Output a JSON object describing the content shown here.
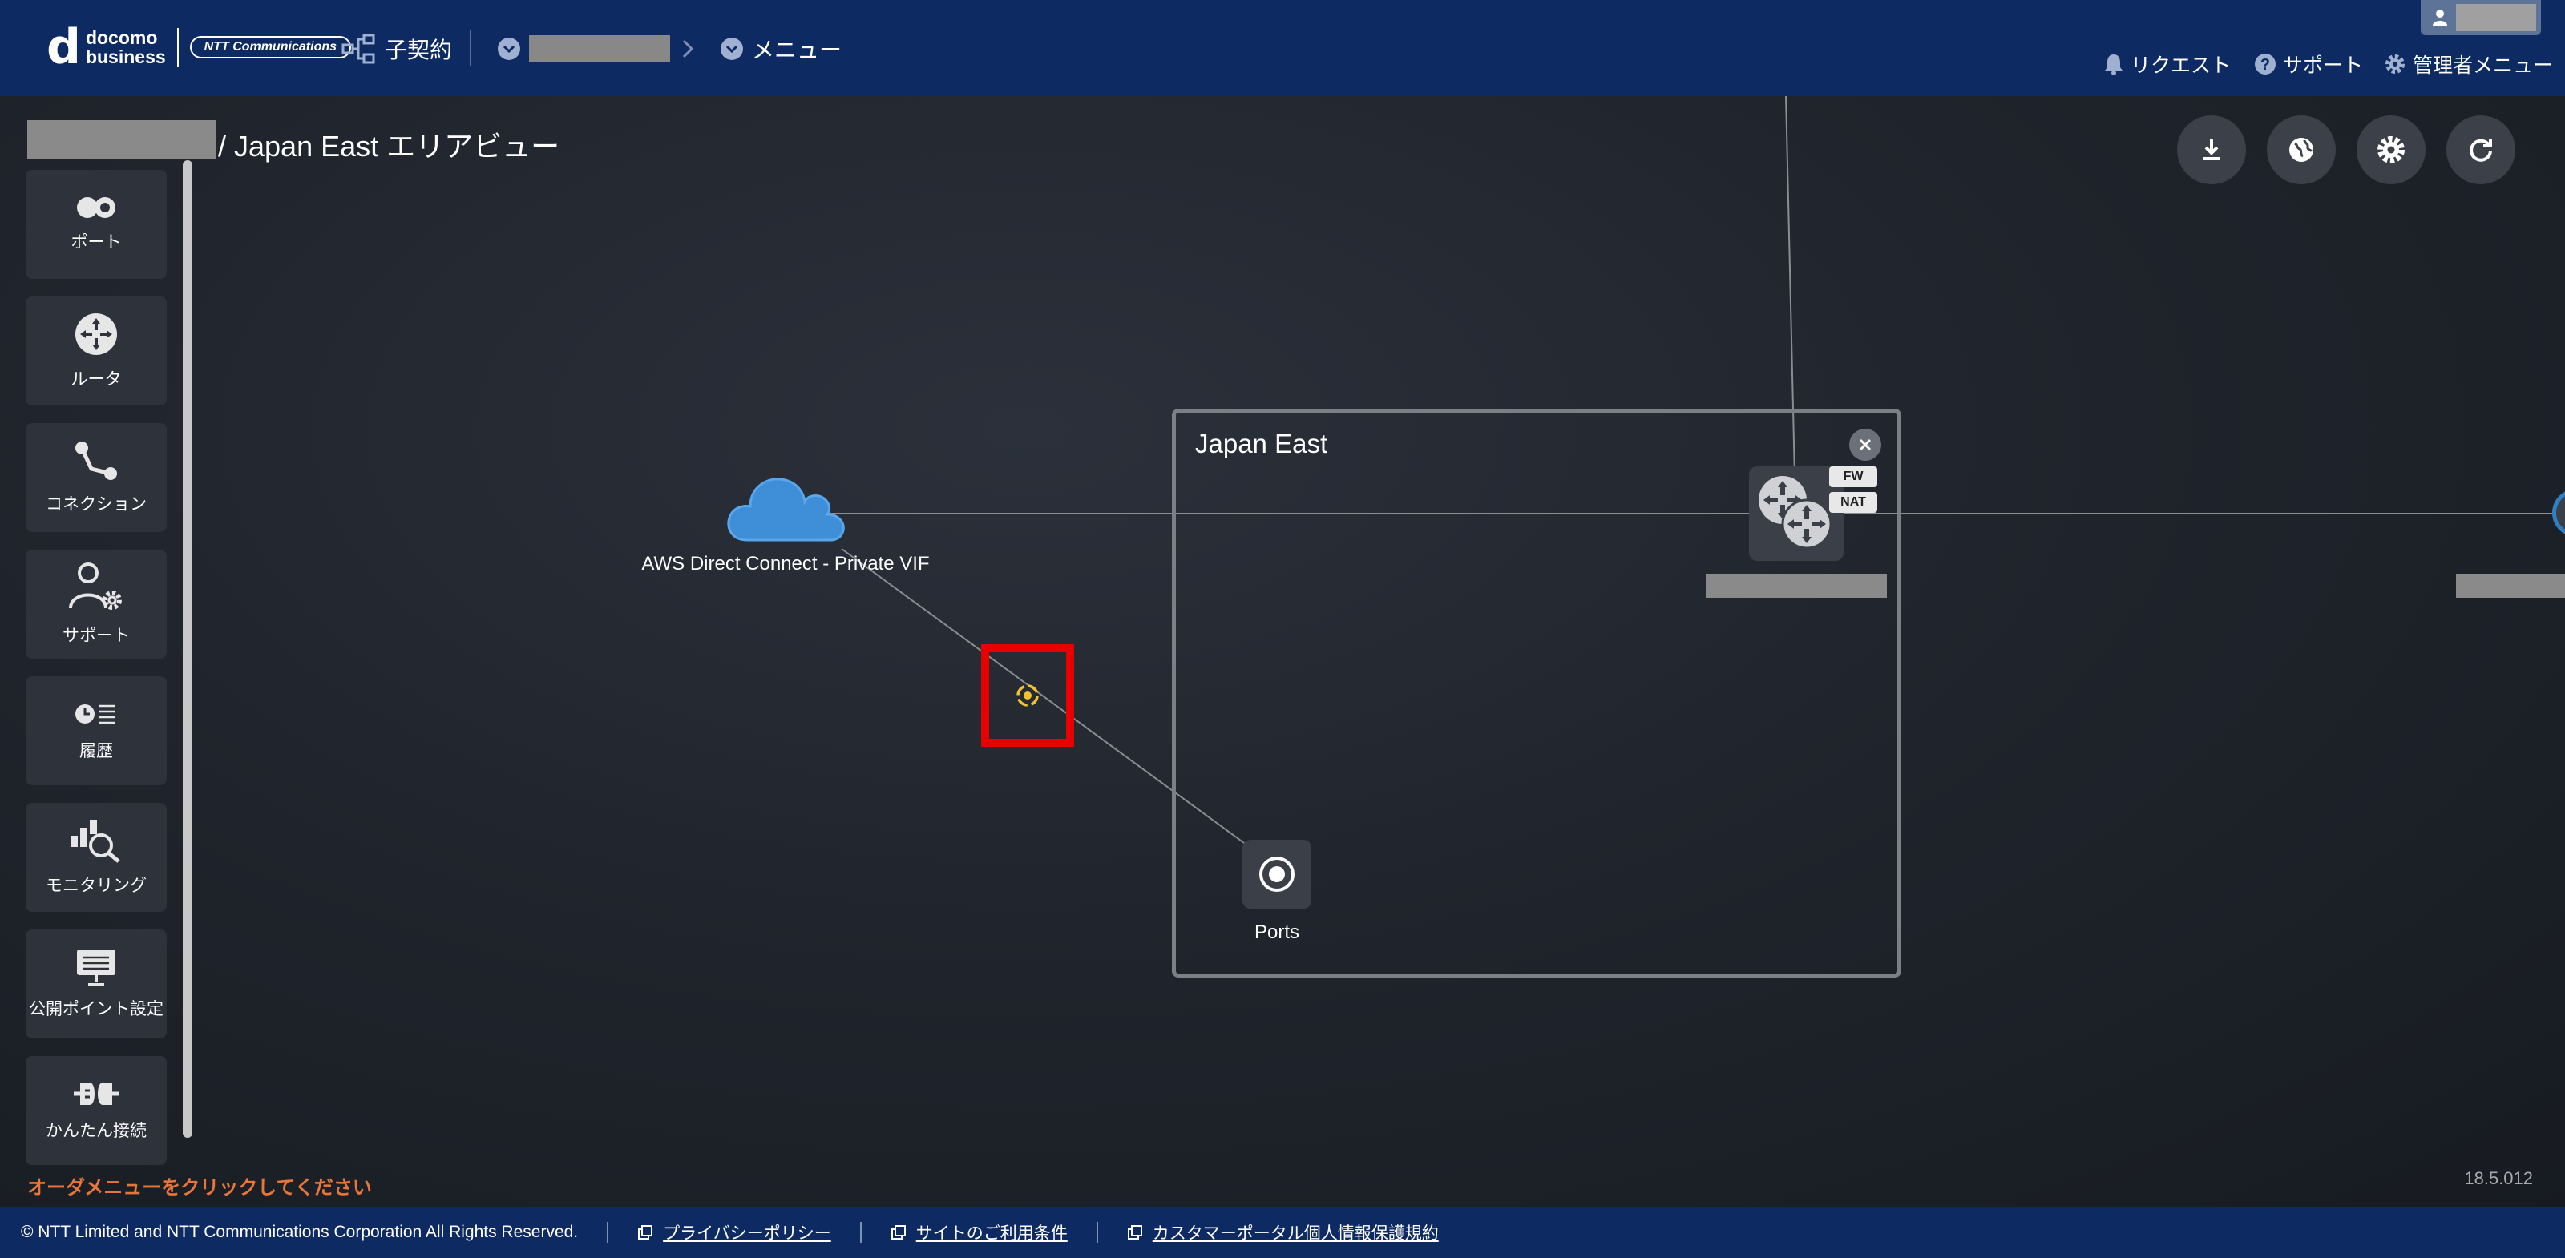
{
  "header": {
    "logo": {
      "mark": "d",
      "line1": "docomo",
      "line2": "business",
      "partner": "NTT Communications"
    },
    "child_contract": "子契約",
    "breadcrumb_menu": "メニュー",
    "links": {
      "request": "リクエスト",
      "support": "サポート",
      "admin_menu": "管理者メニュー"
    }
  },
  "page": {
    "title": "/ Japan East エリアビュー"
  },
  "sidebar": {
    "items": [
      {
        "label": "ポート",
        "icon": "port-icon"
      },
      {
        "label": "ルータ",
        "icon": "router-icon"
      },
      {
        "label": "コネクション",
        "icon": "connection-icon"
      },
      {
        "label": "サポート",
        "icon": "support-user-gear-icon"
      },
      {
        "label": "履歴",
        "icon": "history-icon"
      },
      {
        "label": "モニタリング",
        "icon": "monitoring-icon"
      },
      {
        "label": "公開ポイント設定",
        "icon": "public-point-icon"
      },
      {
        "label": "かんたん接続",
        "icon": "easy-connect-icon"
      }
    ]
  },
  "toolbar": {
    "icons": [
      "download-icon",
      "globe-icon",
      "gear-icon",
      "refresh-icon"
    ]
  },
  "diagram": {
    "aws_label": "AWS Direct Connect - Private VIF",
    "region_title": "Japan East",
    "router_tags": [
      "FW",
      "NAT"
    ],
    "ports_label": "Ports"
  },
  "status": {
    "order_hint": "オーダメニューをクリックしてください",
    "version": "18.5.012"
  },
  "footer": {
    "copyright": "© NTT Limited and NTT Communications Corporation All Rights Reserved.",
    "privacy": "プライバシーポリシー",
    "terms": "サイトのご利用条件",
    "customer_privacy": "カスタマーポータル個人情報保護規約"
  },
  "colors": {
    "header_bg": "#0e2a63",
    "accent_orange": "#e8763a",
    "highlight_red": "#e60000",
    "status_yellow": "#f2c12e",
    "cloud_blue": "#3f8fd8"
  }
}
